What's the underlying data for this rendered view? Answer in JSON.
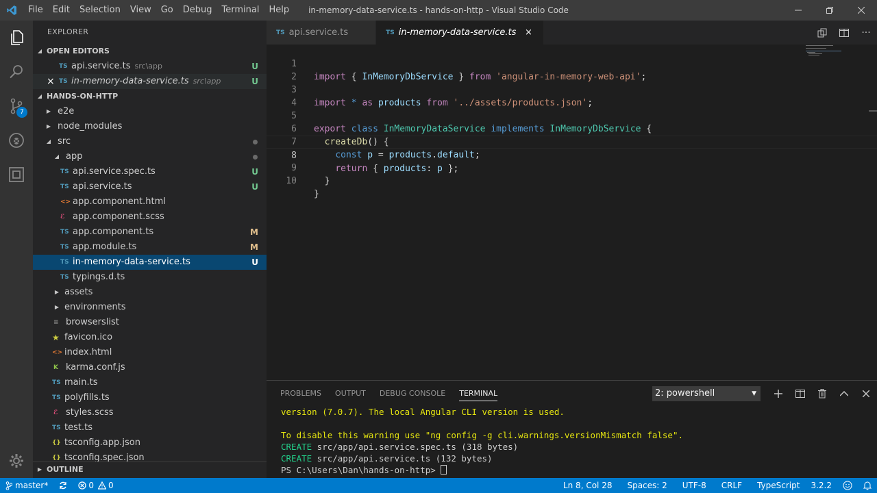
{
  "window": {
    "title": "in-memory-data-service.ts - hands-on-http - Visual Studio Code",
    "menu": [
      "File",
      "Edit",
      "Selection",
      "View",
      "Go",
      "Debug",
      "Terminal",
      "Help"
    ]
  },
  "activity": {
    "scm_badge": "7"
  },
  "sidebar": {
    "title": "EXPLORER",
    "open_editors_label": "OPEN EDITORS",
    "open_editors": [
      {
        "icon": "TS",
        "name": "api.service.ts",
        "path": "src\\app",
        "status": "U"
      },
      {
        "icon": "TS",
        "name": "in-memory-data-service.ts",
        "path": "src\\app",
        "status": "U",
        "close": "×"
      }
    ],
    "project_label": "HANDS-ON-HTTP",
    "tree": [
      {
        "twisty": "▶",
        "name": "e2e"
      },
      {
        "twisty": "▶",
        "name": "node_modules"
      },
      {
        "twisty": "◢",
        "name": "src"
      },
      {
        "twisty": "◢",
        "name": "app"
      },
      {
        "icon": "TS",
        "name": "api.service.spec.ts",
        "status": "U"
      },
      {
        "icon": "TS",
        "name": "api.service.ts",
        "status": "U"
      },
      {
        "icon": "<>",
        "name": "app.component.html"
      },
      {
        "icon": "ℰ",
        "name": "app.component.scss"
      },
      {
        "icon": "TS",
        "name": "app.component.ts",
        "status": "M"
      },
      {
        "icon": "TS",
        "name": "app.module.ts",
        "status": "M"
      },
      {
        "icon": "TS",
        "name": "in-memory-data-service.ts",
        "status": "U"
      },
      {
        "icon": "TS",
        "name": "typings.d.ts"
      },
      {
        "twisty": "▶",
        "name": "assets"
      },
      {
        "twisty": "▶",
        "name": "environments"
      },
      {
        "icon": "≡",
        "name": "browserslist"
      },
      {
        "icon": "★",
        "name": "favicon.ico"
      },
      {
        "icon": "<>",
        "name": "index.html"
      },
      {
        "icon": "K",
        "name": "karma.conf.js"
      },
      {
        "icon": "TS",
        "name": "main.ts"
      },
      {
        "icon": "TS",
        "name": "polyfills.ts"
      },
      {
        "icon": "ℰ",
        "name": "styles.scss"
      },
      {
        "icon": "TS",
        "name": "test.ts"
      },
      {
        "icon": "{}",
        "name": "tsconfig.app.json"
      },
      {
        "icon": "{}",
        "name": "tsconfig.spec.json"
      }
    ],
    "outline_label": "OUTLINE"
  },
  "tabs": [
    {
      "icon": "TS",
      "name": "api.service.ts"
    },
    {
      "icon": "TS",
      "name": "in-memory-data-service.ts",
      "close": "×"
    }
  ],
  "editor": {
    "line_numbers": [
      "1",
      "2",
      "3",
      "4",
      "5",
      "6",
      "7",
      "8",
      "9",
      "10"
    ],
    "current_line": "8"
  },
  "panel": {
    "tabs": [
      "PROBLEMS",
      "OUTPUT",
      "DEBUG CONSOLE",
      "TERMINAL"
    ],
    "terminal_select": "2: powershell",
    "terminal": {
      "line1": "version (7.0.7). The local Angular CLI version is used.",
      "line2": "To disable this warning use \"ng config -g cli.warnings.versionMismatch false\".",
      "create_word": "CREATE",
      "line3": " src/app/api.service.spec.ts (318 bytes)",
      "line4": " src/app/api.service.ts (132 bytes)",
      "prompt": "PS C:\\Users\\Dan\\hands-on-http> "
    }
  },
  "statusbar": {
    "branch": "master*",
    "errors": "0",
    "warnings": "0",
    "position": "Ln 8, Col 28",
    "spaces": "Spaces: 2",
    "encoding": "UTF-8",
    "eol": "CRLF",
    "language": "TypeScript",
    "version": "3.2.2"
  },
  "colors": {
    "accent": "#007acc",
    "selection": "#094771",
    "untracked": "#73c991",
    "modified": "#e2c08d"
  }
}
